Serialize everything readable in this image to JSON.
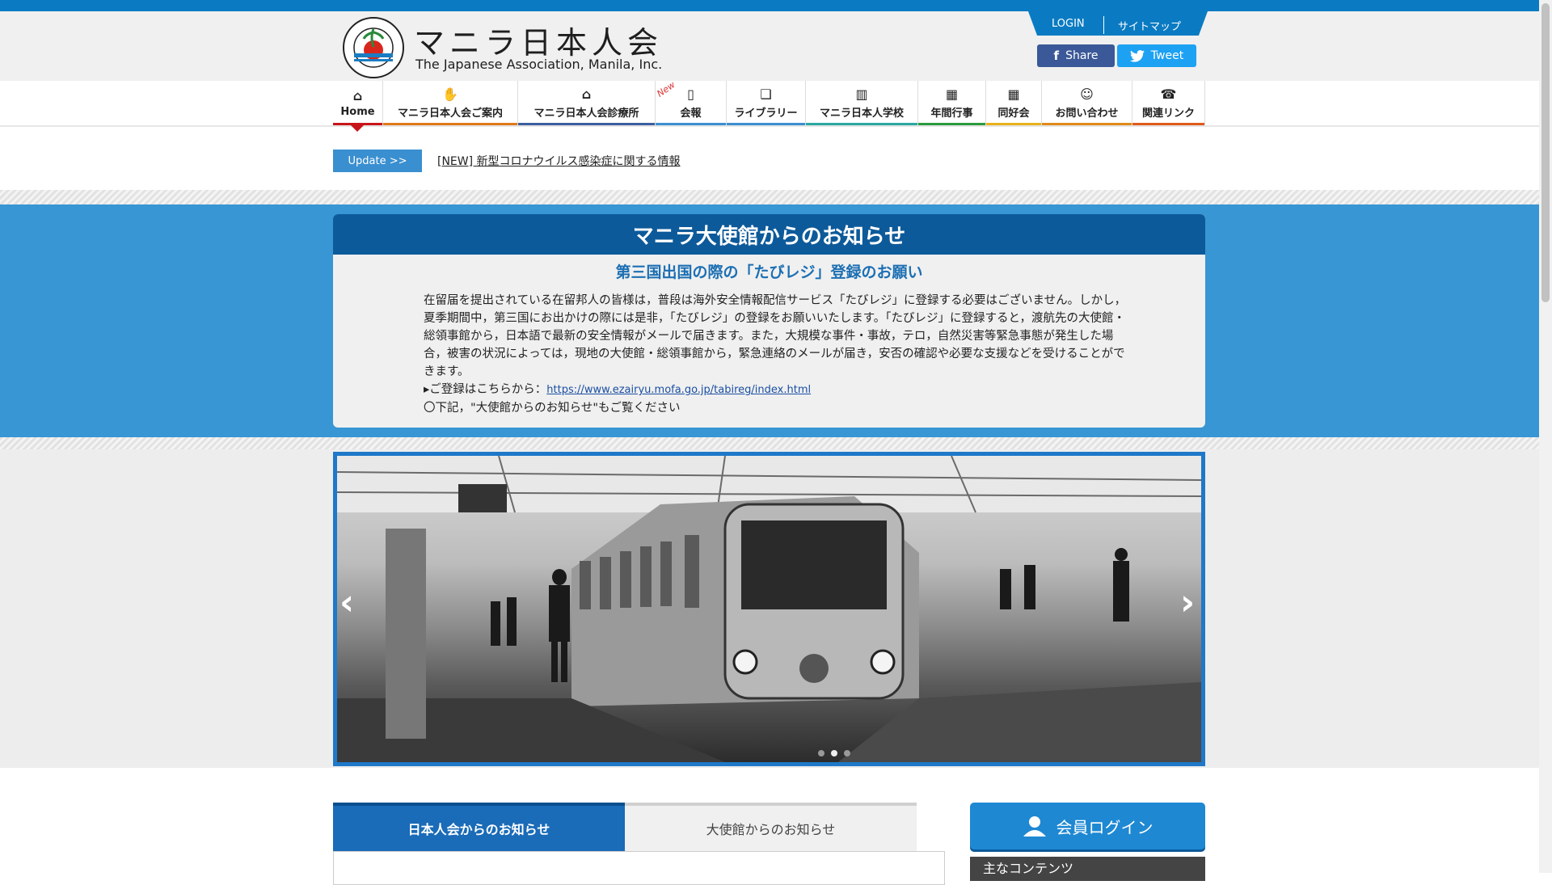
{
  "header": {
    "title_ja": "マニラ日本人会",
    "title_en": "The Japanese Association, Manila, Inc.",
    "logo_text": "THE JAPANESE ASSOCIATION, MANILA, INC.",
    "login": "LOGIN",
    "sitemap": "サイトマップ",
    "share": "Share",
    "tweet": "Tweet"
  },
  "nav": {
    "items": [
      {
        "label": "Home",
        "icon": "home-icon",
        "color": "#c8151b"
      },
      {
        "label": "マニラ日本人会ご案内",
        "icon": "handshake-icon",
        "color": "#e07a1a"
      },
      {
        "label": "マニラ日本人会診療所",
        "icon": "clinic-icon",
        "color": "#3b5f9f"
      },
      {
        "label": "会報",
        "icon": "bag-icon",
        "color": "#3b8fd0"
      },
      {
        "label": "ライブラリー",
        "icon": "book-icon",
        "color": "#3b8fd0"
      },
      {
        "label": "マニラ日本人学校",
        "icon": "school-icon",
        "color": "#2aa7a0"
      },
      {
        "label": "年間行事",
        "icon": "calendar-event-icon",
        "color": "#2a9a3c"
      },
      {
        "label": "同好会",
        "icon": "calendar-icon",
        "color": "#e8b21a"
      },
      {
        "label": "お問い合わせ",
        "icon": "people-icon",
        "color": "#e08a1a"
      },
      {
        "label": "関連リンク",
        "icon": "phone-icon",
        "color": "#e05a1a"
      }
    ],
    "new_tag": "New"
  },
  "update": {
    "button": "Update >>",
    "link": "[NEW] 新型コロナウイルス感染症に関する情報"
  },
  "notice": {
    "title": "マニラ大使館からのお知らせ",
    "subtitle": "第三国出国の際の「たびレジ」登録のお願い",
    "body": "在留届を提出されている在留邦人の皆様は，普段は海外安全情報配信サービス「たびレジ」に登録する必要はございません。しかし，夏季期間中，第三国にお出かけの際には是非，「たびレジ」の登録をお願いいたします。「たびレジ」に登録すると，渡航先の大使館・総領事館から，日本語で最新の安全情報がメールで届きます。また，大規模な事件・事故，テロ，自然災害等緊急事態が発生した場合，被害の状況によっては，現地の大使館・総領事館から，緊急連絡のメールが届き，安否の確認や必要な支援などを受けることができます。",
    "register_prefix": "▸ご登録はこちらから：",
    "register_link": "https://www.ezairyu.mofa.go.jp/tabireg/index.html",
    "footer": "〇下記，\"大使館からのお知らせ\"もご覧ください"
  },
  "slider": {
    "prev": "‹",
    "next": "›",
    "total": 3,
    "active": 1
  },
  "tabs": {
    "active": "日本人会からのお知らせ",
    "inactive": "大使館からのお知らせ"
  },
  "sidebar": {
    "member_login": "会員ログイン",
    "main_contents": "主なコンテンツ"
  }
}
